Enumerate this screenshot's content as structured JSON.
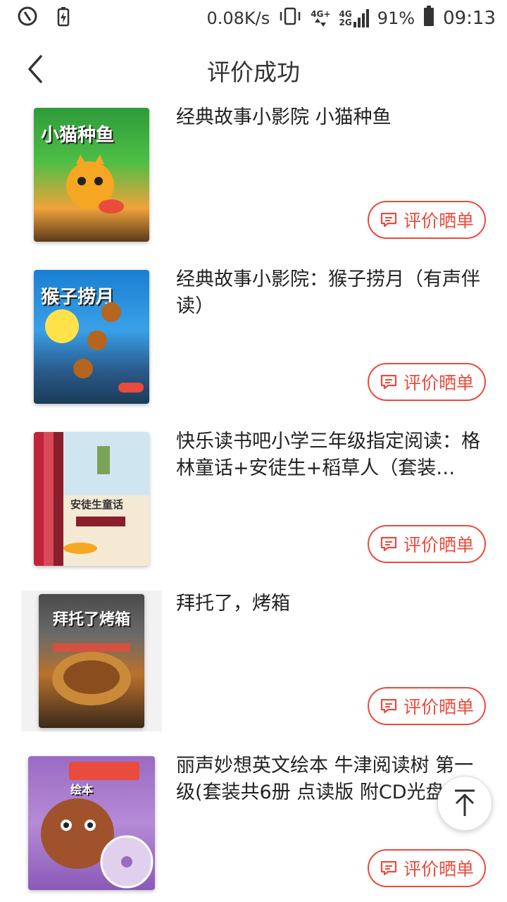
{
  "status_bar": {
    "speed": "0.08K/s",
    "network_primary": "4G+",
    "network_secondary_top": "4G",
    "network_secondary_bottom": "2G",
    "battery": "91%",
    "time": "09:13",
    "icons": [
      "key-icon",
      "battery-saver-icon",
      "vibrate-icon",
      "data-arrows-icon",
      "signal-icon",
      "battery-icon"
    ]
  },
  "header": {
    "title": "评价成功",
    "back_icon": "chevron-left-icon"
  },
  "items": [
    {
      "name": "经典故事小影院 小猫种鱼",
      "cover_text": "小猫种鱼",
      "button": "评价晒单"
    },
    {
      "name": "经典故事小影院：猴子捞月（有声伴读）",
      "cover_text": "猴子捞月",
      "button": "评价晒单"
    },
    {
      "name": "快乐读书吧小学三年级指定阅读：格林童话+安徒生+稻草人（套装…",
      "cover_text": "安徒生童话",
      "button": "评价晒单"
    },
    {
      "name": "拜托了，烤箱",
      "cover_text": "拜托了烤箱",
      "button": "评价晒单"
    },
    {
      "name": "丽声妙想英文绘本 牛津阅读树 第一级(套装共6册 点读版 附CD光盘",
      "cover_text": "丽声妙想英文绘本",
      "button": "评价晒单"
    }
  ],
  "colors": {
    "accent": "#e94b3c"
  },
  "fab_icon": "arrow-up-icon"
}
